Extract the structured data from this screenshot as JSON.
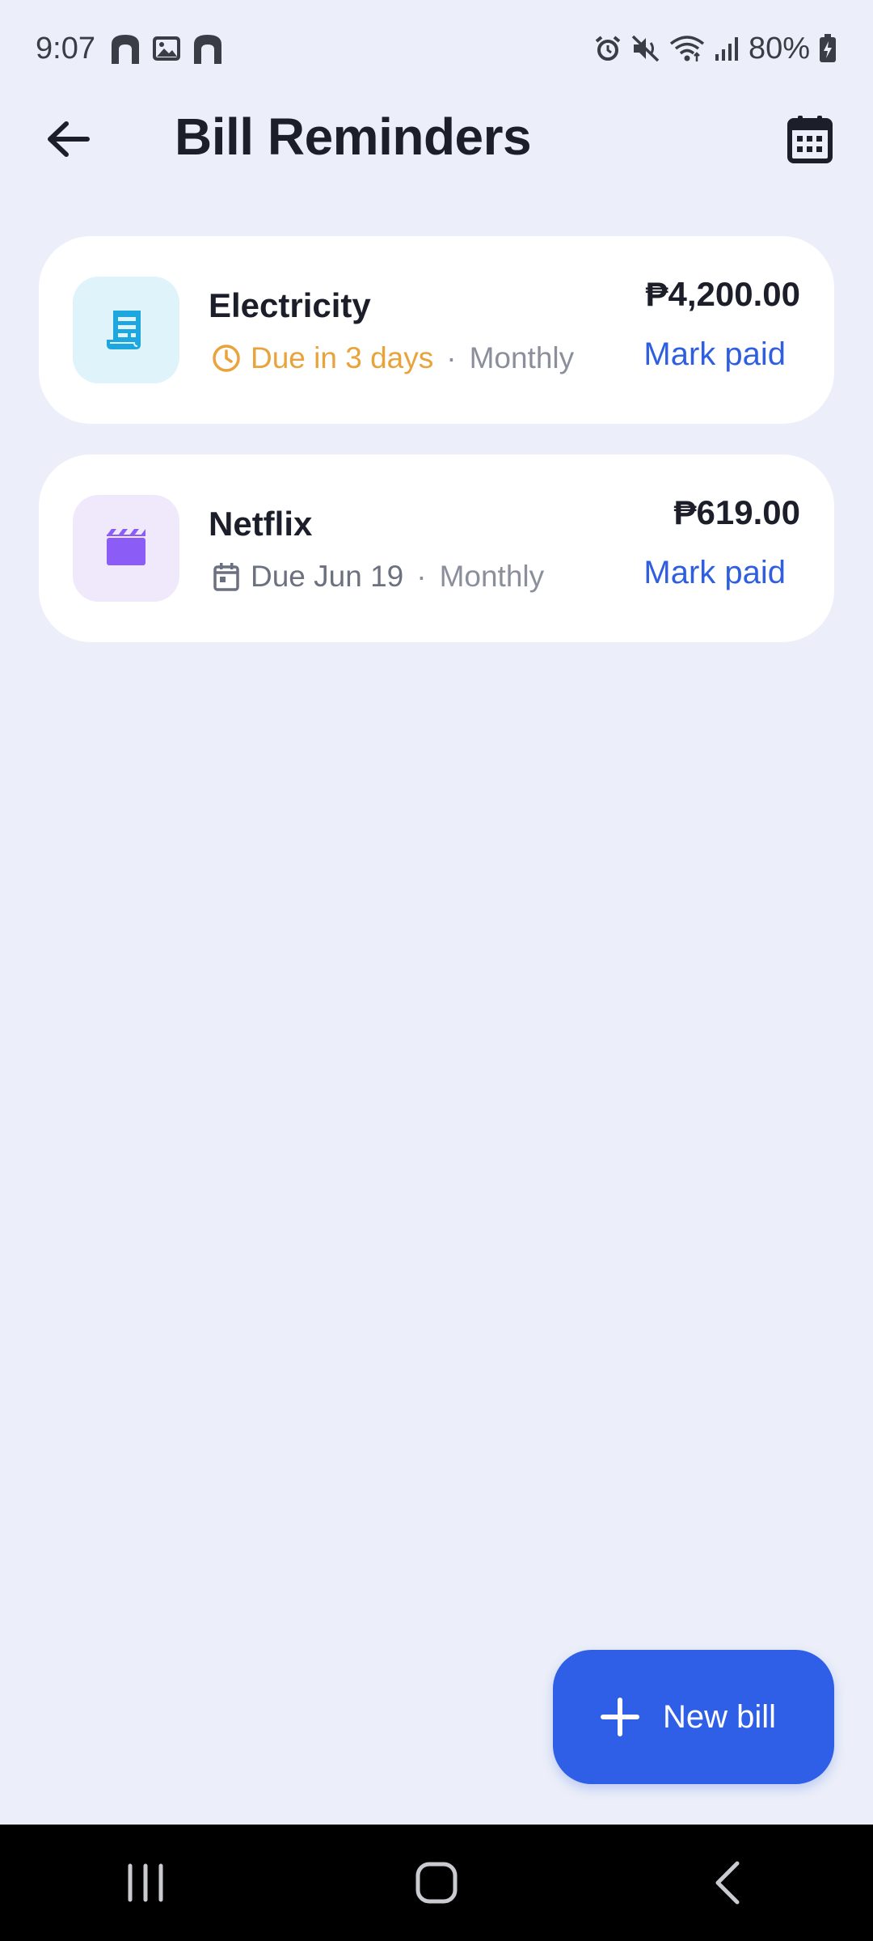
{
  "status_bar": {
    "time": "9:07",
    "battery_percent": "80%",
    "left_icons": [
      "home-notification-icon",
      "image-notification-icon",
      "home-notification-icon"
    ],
    "right_icons": [
      "alarm-icon",
      "mute-icon",
      "wifi-icon",
      "signal-icon",
      "battery-icon"
    ]
  },
  "header": {
    "title": "Bill Reminders",
    "back_icon": "arrow-left-icon",
    "calendar_icon": "calendar-icon"
  },
  "bills": [
    {
      "name": "Electricity",
      "icon": "receipt-icon",
      "icon_bg": "#dff3fb",
      "icon_color": "#1ea7df",
      "due_text": "Due in 3 days",
      "due_icon": "clock-icon",
      "due_color": "#e8a33a",
      "frequency": "Monthly",
      "separator": "·",
      "amount": "₱4,200.00",
      "action": "Mark paid"
    },
    {
      "name": "Netflix",
      "icon": "movie-clapper-icon",
      "icon_bg": "#efe9fb",
      "icon_color": "#8b5cf6",
      "due_text": "Due Jun 19",
      "due_icon": "calendar-small-icon",
      "due_color": "#6c7180",
      "frequency": "Monthly",
      "separator": "·",
      "amount": "₱619.00",
      "action": "Mark paid"
    }
  ],
  "fab": {
    "label": "New bill",
    "icon": "plus-icon",
    "color": "#2e5fe6"
  },
  "nav_bar": {
    "buttons": [
      "recent-apps-icon",
      "home-icon",
      "back-icon"
    ]
  },
  "colors": {
    "background": "#eceff9",
    "card": "#ffffff",
    "accent": "#2f5fe0"
  }
}
